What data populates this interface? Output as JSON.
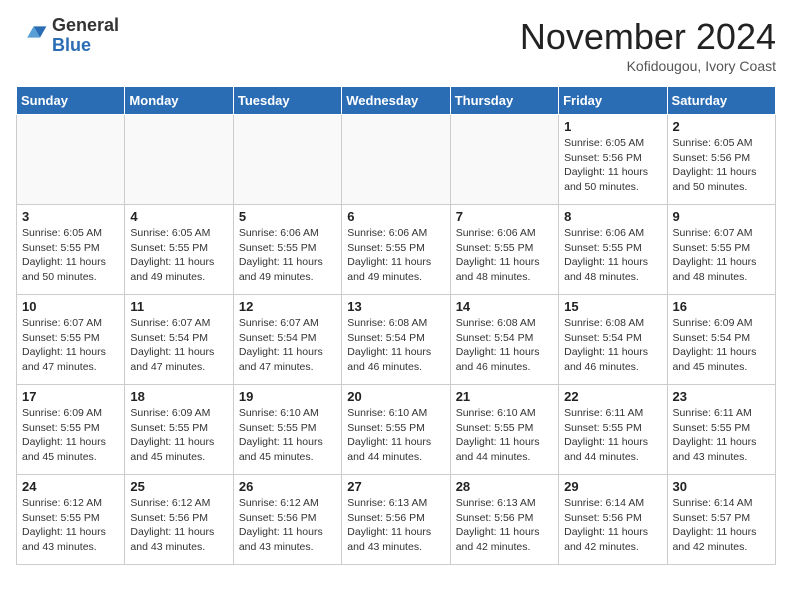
{
  "header": {
    "logo_general": "General",
    "logo_blue": "Blue",
    "month_year": "November 2024",
    "location": "Kofidougou, Ivory Coast"
  },
  "weekdays": [
    "Sunday",
    "Monday",
    "Tuesday",
    "Wednesday",
    "Thursday",
    "Friday",
    "Saturday"
  ],
  "weeks": [
    [
      {
        "day": "",
        "detail": ""
      },
      {
        "day": "",
        "detail": ""
      },
      {
        "day": "",
        "detail": ""
      },
      {
        "day": "",
        "detail": ""
      },
      {
        "day": "",
        "detail": ""
      },
      {
        "day": "1",
        "detail": "Sunrise: 6:05 AM\nSunset: 5:56 PM\nDaylight: 11 hours\nand 50 minutes."
      },
      {
        "day": "2",
        "detail": "Sunrise: 6:05 AM\nSunset: 5:56 PM\nDaylight: 11 hours\nand 50 minutes."
      }
    ],
    [
      {
        "day": "3",
        "detail": "Sunrise: 6:05 AM\nSunset: 5:55 PM\nDaylight: 11 hours\nand 50 minutes."
      },
      {
        "day": "4",
        "detail": "Sunrise: 6:05 AM\nSunset: 5:55 PM\nDaylight: 11 hours\nand 49 minutes."
      },
      {
        "day": "5",
        "detail": "Sunrise: 6:06 AM\nSunset: 5:55 PM\nDaylight: 11 hours\nand 49 minutes."
      },
      {
        "day": "6",
        "detail": "Sunrise: 6:06 AM\nSunset: 5:55 PM\nDaylight: 11 hours\nand 49 minutes."
      },
      {
        "day": "7",
        "detail": "Sunrise: 6:06 AM\nSunset: 5:55 PM\nDaylight: 11 hours\nand 48 minutes."
      },
      {
        "day": "8",
        "detail": "Sunrise: 6:06 AM\nSunset: 5:55 PM\nDaylight: 11 hours\nand 48 minutes."
      },
      {
        "day": "9",
        "detail": "Sunrise: 6:07 AM\nSunset: 5:55 PM\nDaylight: 11 hours\nand 48 minutes."
      }
    ],
    [
      {
        "day": "10",
        "detail": "Sunrise: 6:07 AM\nSunset: 5:55 PM\nDaylight: 11 hours\nand 47 minutes."
      },
      {
        "day": "11",
        "detail": "Sunrise: 6:07 AM\nSunset: 5:54 PM\nDaylight: 11 hours\nand 47 minutes."
      },
      {
        "day": "12",
        "detail": "Sunrise: 6:07 AM\nSunset: 5:54 PM\nDaylight: 11 hours\nand 47 minutes."
      },
      {
        "day": "13",
        "detail": "Sunrise: 6:08 AM\nSunset: 5:54 PM\nDaylight: 11 hours\nand 46 minutes."
      },
      {
        "day": "14",
        "detail": "Sunrise: 6:08 AM\nSunset: 5:54 PM\nDaylight: 11 hours\nand 46 minutes."
      },
      {
        "day": "15",
        "detail": "Sunrise: 6:08 AM\nSunset: 5:54 PM\nDaylight: 11 hours\nand 46 minutes."
      },
      {
        "day": "16",
        "detail": "Sunrise: 6:09 AM\nSunset: 5:54 PM\nDaylight: 11 hours\nand 45 minutes."
      }
    ],
    [
      {
        "day": "17",
        "detail": "Sunrise: 6:09 AM\nSunset: 5:55 PM\nDaylight: 11 hours\nand 45 minutes."
      },
      {
        "day": "18",
        "detail": "Sunrise: 6:09 AM\nSunset: 5:55 PM\nDaylight: 11 hours\nand 45 minutes."
      },
      {
        "day": "19",
        "detail": "Sunrise: 6:10 AM\nSunset: 5:55 PM\nDaylight: 11 hours\nand 45 minutes."
      },
      {
        "day": "20",
        "detail": "Sunrise: 6:10 AM\nSunset: 5:55 PM\nDaylight: 11 hours\nand 44 minutes."
      },
      {
        "day": "21",
        "detail": "Sunrise: 6:10 AM\nSunset: 5:55 PM\nDaylight: 11 hours\nand 44 minutes."
      },
      {
        "day": "22",
        "detail": "Sunrise: 6:11 AM\nSunset: 5:55 PM\nDaylight: 11 hours\nand 44 minutes."
      },
      {
        "day": "23",
        "detail": "Sunrise: 6:11 AM\nSunset: 5:55 PM\nDaylight: 11 hours\nand 43 minutes."
      }
    ],
    [
      {
        "day": "24",
        "detail": "Sunrise: 6:12 AM\nSunset: 5:55 PM\nDaylight: 11 hours\nand 43 minutes."
      },
      {
        "day": "25",
        "detail": "Sunrise: 6:12 AM\nSunset: 5:56 PM\nDaylight: 11 hours\nand 43 minutes."
      },
      {
        "day": "26",
        "detail": "Sunrise: 6:12 AM\nSunset: 5:56 PM\nDaylight: 11 hours\nand 43 minutes."
      },
      {
        "day": "27",
        "detail": "Sunrise: 6:13 AM\nSunset: 5:56 PM\nDaylight: 11 hours\nand 43 minutes."
      },
      {
        "day": "28",
        "detail": "Sunrise: 6:13 AM\nSunset: 5:56 PM\nDaylight: 11 hours\nand 42 minutes."
      },
      {
        "day": "29",
        "detail": "Sunrise: 6:14 AM\nSunset: 5:56 PM\nDaylight: 11 hours\nand 42 minutes."
      },
      {
        "day": "30",
        "detail": "Sunrise: 6:14 AM\nSunset: 5:57 PM\nDaylight: 11 hours\nand 42 minutes."
      }
    ]
  ]
}
